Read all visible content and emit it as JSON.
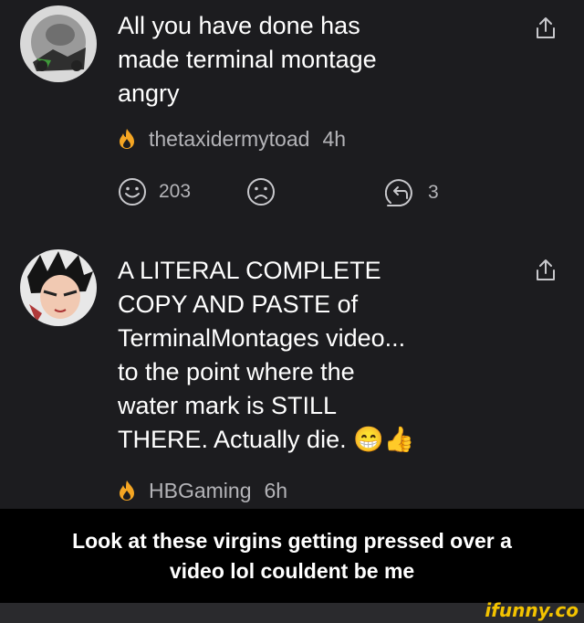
{
  "comments": [
    {
      "text": "All you have done has\nmade terminal montage\nangry",
      "author": "thetaxidermytoad",
      "time": "4h",
      "likes": "203",
      "replies": "3"
    },
    {
      "text": "A LITERAL COMPLETE\nCOPY AND PASTE of\nTerminalMontages video...\nto the point where the\nwater mark is STILL\nTHERE. Actually die. 😁👍",
      "author": "HBGaming",
      "time": "6h"
    }
  ],
  "caption": "Look at these virgins getting pressed over a\nvideo lol couldent be me",
  "watermark": "ifunny.co",
  "colors": {
    "background": "#1c1c1f",
    "meta_text": "#b4b4b8",
    "flame": "#f5a623",
    "watermark": "#f3c300"
  },
  "icons": [
    "share-icon",
    "flame-icon",
    "smile-icon",
    "frown-icon",
    "reply-icon"
  ]
}
